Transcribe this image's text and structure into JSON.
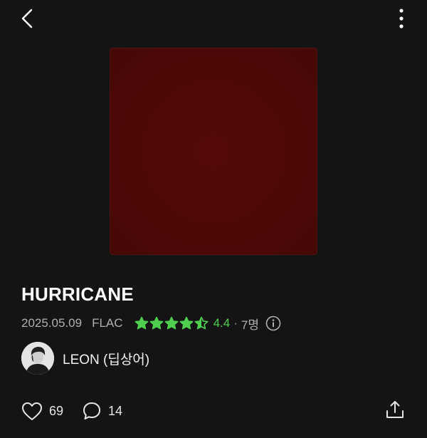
{
  "album": {
    "title": "HURRICANE",
    "release_date": "2025.05.09",
    "format": "FLAC",
    "rating": {
      "value": "4.4",
      "stars_filled": 4.5,
      "stars_max": 5,
      "reviewer_count": "7명",
      "star_color": "#4fcf4f"
    },
    "cover_color": "#4e0808"
  },
  "artist": {
    "name": "LEON (딥상어)"
  },
  "actions": {
    "likes": "69",
    "comments": "14"
  },
  "icons": {
    "back": "chevron-left-icon",
    "more": "more-vertical-icon",
    "like": "heart-icon",
    "comment": "chat-bubble-icon",
    "share": "share-icon",
    "info": "info-icon"
  }
}
